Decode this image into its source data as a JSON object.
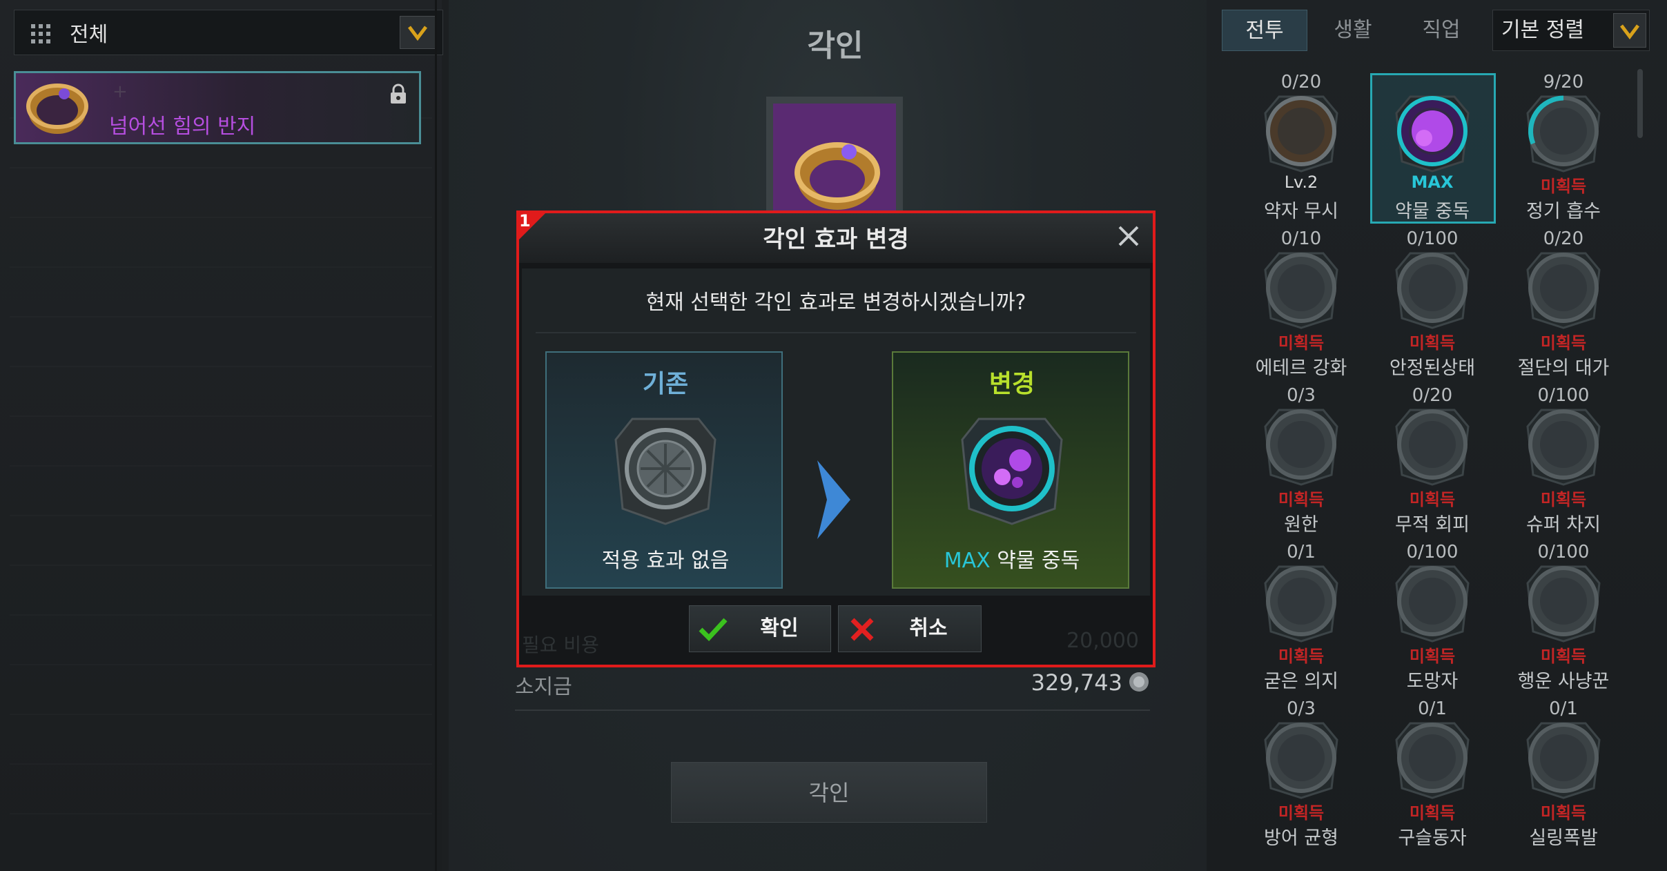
{
  "left": {
    "filter": {
      "label": "전체"
    },
    "item": {
      "name": "넘어선 힘의 반지",
      "plus": "+"
    }
  },
  "center": {
    "title": "각인",
    "money": {
      "label": "소지금",
      "value": "329,743"
    },
    "engrave_button": "각인"
  },
  "modal": {
    "badge": "1",
    "title": "각인 효과 변경",
    "question": "현재 선택한 각인 효과로 변경하시겠습니까?",
    "current": {
      "title": "기존",
      "label": "적용 효과 없음"
    },
    "new": {
      "title": "변경",
      "prefix": "MAX",
      "label": "약물 중독"
    },
    "confirm": "확인",
    "cancel": "취소",
    "cost_label": "필요 비용",
    "cost_value": "20,000"
  },
  "right": {
    "tabs": [
      "전투",
      "생활",
      "직업"
    ],
    "active_tab": "전투",
    "sort": "기본 정렬",
    "engravings": [
      {
        "count": "0/20",
        "status": "Lv.2",
        "name": "약자 무시",
        "state": "level"
      },
      {
        "count": "",
        "status": "MAX",
        "name": "약물 중독",
        "state": "max",
        "selected": true
      },
      {
        "count": "9/20",
        "status": "미획득",
        "name": "정기 흡수",
        "state": "locked"
      },
      {
        "count": "0/10",
        "status": "미획득",
        "name": "에테르 강화",
        "state": "locked"
      },
      {
        "count": "0/100",
        "status": "미획득",
        "name": "안정된상태",
        "state": "locked"
      },
      {
        "count": "0/20",
        "status": "미획득",
        "name": "절단의 대가",
        "state": "locked"
      },
      {
        "count": "0/3",
        "status": "미획득",
        "name": "원한",
        "state": "locked"
      },
      {
        "count": "0/20",
        "status": "미획득",
        "name": "무적 회피",
        "state": "locked"
      },
      {
        "count": "0/100",
        "status": "미획득",
        "name": "슈퍼 차지",
        "state": "locked"
      },
      {
        "count": "0/1",
        "status": "미획득",
        "name": "굳은 의지",
        "state": "locked"
      },
      {
        "count": "0/100",
        "status": "미획득",
        "name": "도망자",
        "state": "locked"
      },
      {
        "count": "0/100",
        "status": "미획득",
        "name": "행운 사냥꾼",
        "state": "locked"
      },
      {
        "count": "0/3",
        "status": "미획득",
        "name": "방어 균형",
        "state": "locked"
      },
      {
        "count": "0/1",
        "status": "미획득",
        "name": "구슬동자",
        "state": "locked"
      },
      {
        "count": "0/1",
        "status": "미획득",
        "name": "실링폭발",
        "state": "locked"
      }
    ]
  },
  "colors": {
    "accent_cyan": "#28c6d8",
    "locked_red": "#c42525",
    "item_purple": "#b64ee0",
    "highlight_red": "#e01b1b",
    "change_green": "#b8e02c"
  },
  "icons": [
    "grid-icon",
    "chevron-down-icon",
    "ring-icon",
    "lock-icon",
    "close-icon",
    "check-icon",
    "x-icon",
    "arrow-right-icon",
    "coin-icon",
    "emblem-icon"
  ]
}
